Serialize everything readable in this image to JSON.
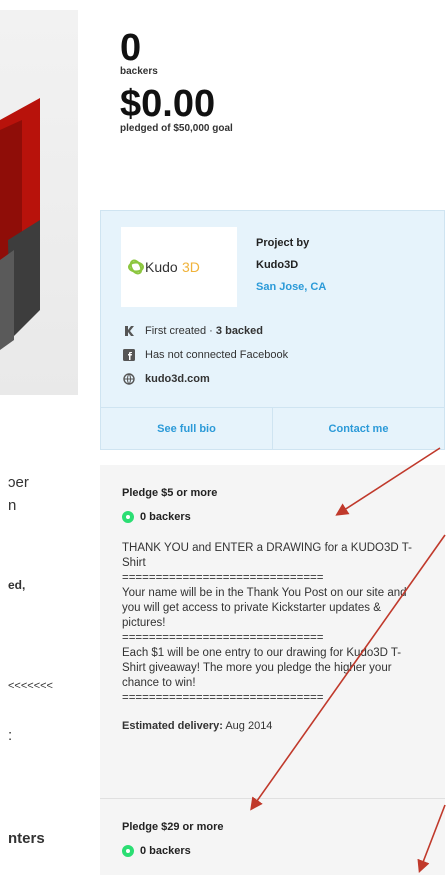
{
  "stats": {
    "backers_count": "0",
    "backers_label": "backers",
    "pledged": "$0.00",
    "pledged_label": "pledged of $50,000 goal"
  },
  "left_column": {
    "fragments": [
      "ɔer",
      "n",
      "ed,",
      "<<<<<<<",
      ":",
      "nters"
    ]
  },
  "creator": {
    "logo_text": "Kudo3D",
    "project_by_label": "Project by",
    "name": "Kudo3D",
    "location": "San Jose, CA",
    "first_created_text": "First created · ",
    "backed_text": "3 backed",
    "facebook_text": "Has not connected Facebook",
    "website": "kudo3d.com",
    "see_bio_label": "See full bio",
    "contact_label": "Contact me"
  },
  "rewards": [
    {
      "title": "Pledge $5 or more",
      "backers": "0 backers",
      "description": [
        "THANK YOU and ENTER a DRAWING for a KUDO3D T-Shirt",
        "==============================",
        "Your name will be in the Thank You Post on our site and you will get access to private Kickstarter updates & pictures!",
        "==============================",
        "Each $1 will be one entry to our drawing for Kudo3D T-Shirt giveaway! The more you pledge the higher your chance to win!",
        "=============================="
      ],
      "delivery_label": "Estimated delivery:",
      "delivery_date": "Aug 2014"
    },
    {
      "title": "Pledge $29 or more",
      "backers": "0 backers"
    }
  ],
  "colors": {
    "accent_blue": "#2b9ad8",
    "creator_bg": "#e6f3fb",
    "backer_green": "#2bde73",
    "annotation_red": "#c0392b"
  }
}
